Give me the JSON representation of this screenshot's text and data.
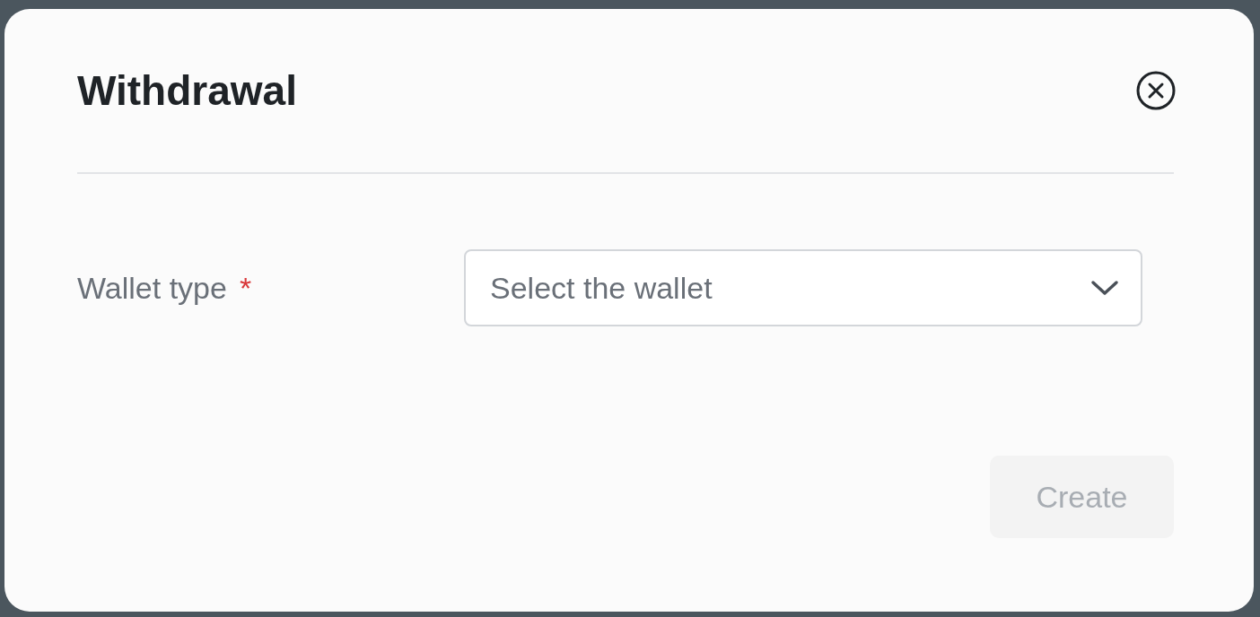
{
  "dialog": {
    "title": "Withdrawal"
  },
  "fields": [
    {
      "label": "Wallet type",
      "required_mark": "*",
      "placeholder": "Select the wallet"
    }
  ],
  "create_button": {
    "label": "Create",
    "disabled": true
  }
}
